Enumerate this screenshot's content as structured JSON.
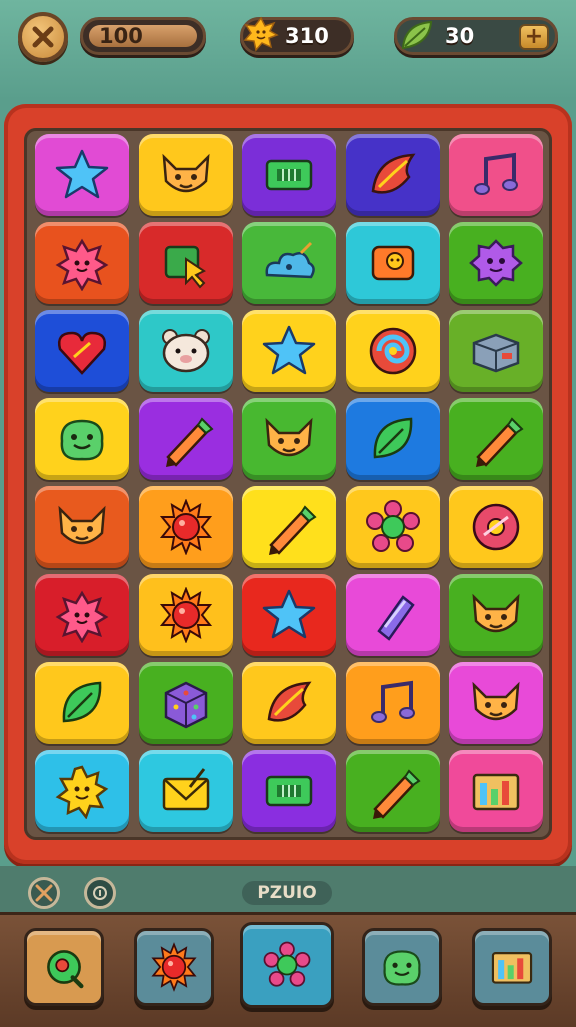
{
  "top": {
    "coins": "100",
    "stars": "310",
    "leaves": "30",
    "plus_label": "+"
  },
  "board": {
    "rows": 8,
    "cols": 5,
    "tiles": [
      {
        "color": "#e14bd4",
        "icon": "star-icon"
      },
      {
        "color": "#ffc81c",
        "icon": "cat-face-icon"
      },
      {
        "color": "#7b2ed8",
        "icon": "ticket-icon"
      },
      {
        "color": "#4632c8",
        "icon": "swirl-leaf-icon"
      },
      {
        "color": "#f0508a",
        "icon": "music-note-icon"
      },
      {
        "color": "#e8521e",
        "icon": "flower-face-icon"
      },
      {
        "color": "#d82a2a",
        "icon": "cursor-box-icon"
      },
      {
        "color": "#48b83a",
        "icon": "cloud-bird-icon"
      },
      {
        "color": "#2ec8d8",
        "icon": "cube-face-icon"
      },
      {
        "color": "#48b020",
        "icon": "gear-blob-icon"
      },
      {
        "color": "#1e4ed8",
        "icon": "heart-icon"
      },
      {
        "color": "#2ec8c8",
        "icon": "bear-face-icon"
      },
      {
        "color": "#ffd21c",
        "icon": "star-icon"
      },
      {
        "color": "#ffd21c",
        "icon": "spiral-icon"
      },
      {
        "color": "#68b028",
        "icon": "box-icon"
      },
      {
        "color": "#ffd21c",
        "icon": "blob-face-icon"
      },
      {
        "color": "#9a2ee0",
        "icon": "pencil-icon"
      },
      {
        "color": "#48b830",
        "icon": "cat-face-icon"
      },
      {
        "color": "#1e7ae0",
        "icon": "leaf-icon"
      },
      {
        "color": "#48b020",
        "icon": "pencil-icon"
      },
      {
        "color": "#e85a1e",
        "icon": "cat-face-icon"
      },
      {
        "color": "#ff9e1c",
        "icon": "sun-ball-icon"
      },
      {
        "color": "#ffe01c",
        "icon": "pencil-icon"
      },
      {
        "color": "#ffc81c",
        "icon": "flower-icon"
      },
      {
        "color": "#ffc81c",
        "icon": "disc-icon"
      },
      {
        "color": "#d81e2a",
        "icon": "flower-face-icon"
      },
      {
        "color": "#ffc01c",
        "icon": "sun-ball-icon"
      },
      {
        "color": "#e8281e",
        "icon": "star-icon"
      },
      {
        "color": "#e84ad8",
        "icon": "crystal-icon"
      },
      {
        "color": "#48b020",
        "icon": "cat-face-icon"
      },
      {
        "color": "#ffc81c",
        "icon": "leaf-icon"
      },
      {
        "color": "#48b020",
        "icon": "dice-icon"
      },
      {
        "color": "#ffc81c",
        "icon": "swirl-leaf-icon"
      },
      {
        "color": "#ff9e1c",
        "icon": "music-note-icon"
      },
      {
        "color": "#e84ad8",
        "icon": "cat-face-icon"
      },
      {
        "color": "#2ec0e8",
        "icon": "sun-face-icon"
      },
      {
        "color": "#2ec8e0",
        "icon": "envelope-icon"
      },
      {
        "color": "#8a2ee0",
        "icon": "ticket-icon"
      },
      {
        "color": "#48b020",
        "icon": "pencil-icon"
      },
      {
        "color": "#f04a9a",
        "icon": "bars-icon"
      }
    ]
  },
  "bottom": {
    "label": "PZUIO",
    "left_icons": [
      "tools-icon",
      "info-icon"
    ],
    "powerups": [
      {
        "color": "#d89a50",
        "icon": "leaf-ring-icon"
      },
      {
        "color": "#5b8c9a",
        "icon": "sun-ball-icon"
      },
      {
        "color": "#3aa0c0",
        "icon": "flower-icon"
      },
      {
        "color": "#5b8c9a",
        "icon": "blob-face-icon"
      },
      {
        "color": "#5b8c9a",
        "icon": "bars-icon"
      }
    ]
  }
}
